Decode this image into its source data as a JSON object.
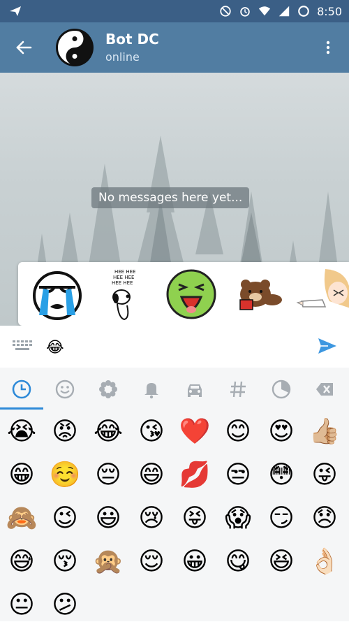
{
  "status_bar": {
    "time": "8:50",
    "icons": [
      "send-icon",
      "do-not-disturb-icon",
      "alarm-icon",
      "wifi-icon",
      "signal-icon",
      "battery-icon"
    ]
  },
  "header": {
    "title": "Bot DC",
    "subtitle": "online",
    "avatar_icon": "yin-yang-icon",
    "back_icon": "back-arrow-icon",
    "menu_icon": "more-vertical-icon"
  },
  "chat": {
    "empty_text": "No messages here yet..."
  },
  "sticker_suggestions": {
    "stickers": [
      "crying-face-sticker",
      "snoopy-laughing-sticker",
      "green-laughing-sticker",
      "brown-bear-sticker",
      "anime-girl-pointing-sticker"
    ],
    "snoopy_caption": "HEE HEE\nHEE HEE\nHEE HEE"
  },
  "input": {
    "text_emoji": "😂",
    "keyboard_icon": "keyboard-icon",
    "send_icon": "send-icon"
  },
  "emoji_tabs": [
    "recent-icon",
    "smiley-icon",
    "flower-icon",
    "bell-icon",
    "car-icon",
    "hashtag-icon",
    "pie-icon",
    "backspace-icon"
  ],
  "emoji_grid": [
    "😭",
    "😡",
    "😂",
    "😘",
    "❤️",
    "😊",
    "😍",
    "👍🏼",
    "😁",
    "☺️",
    "😔",
    "😄",
    "💋",
    "😒",
    "😳",
    "😜",
    "🙈",
    "😉",
    "😃",
    "😢",
    "😝",
    "😱",
    "😏",
    "😞",
    "😅",
    "😚",
    "🙊",
    "😌",
    "😀",
    "😋",
    "😆",
    "👌🏻",
    "😐",
    "😕"
  ],
  "colors": {
    "accent": "#2e8ad8",
    "header": "#517da2",
    "status_bar": "#3b5f86"
  }
}
